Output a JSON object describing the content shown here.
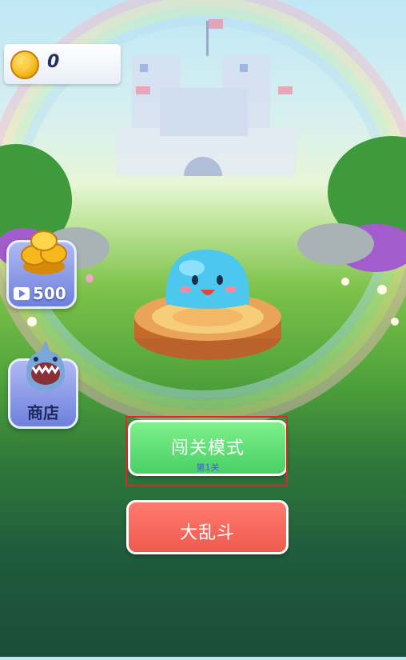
{
  "hud": {
    "coin_count": "0"
  },
  "side": {
    "video_reward": "500",
    "shop_label": "商店"
  },
  "menu": {
    "level_mode": "闯关模式",
    "level_sub": "第1关",
    "brawl": "大乱斗"
  },
  "colors": {
    "accent_green": "#49d066",
    "accent_red": "#ef5a4e",
    "highlight": "#e0262a"
  }
}
